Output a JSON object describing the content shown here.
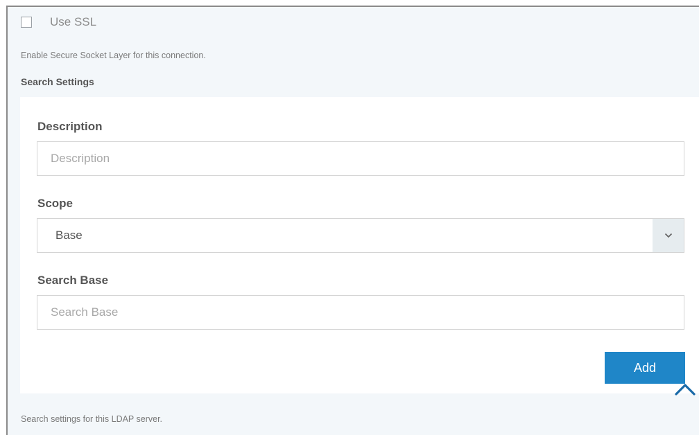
{
  "ssl": {
    "label": "Use SSL",
    "checked": false,
    "help": "Enable Secure Socket Layer for this connection."
  },
  "search_settings": {
    "title": "Search Settings",
    "fields": {
      "description": {
        "label": "Description",
        "placeholder": "Description",
        "value": ""
      },
      "scope": {
        "label": "Scope",
        "value": "Base"
      },
      "search_base": {
        "label": "Search Base",
        "placeholder": "Search Base",
        "value": ""
      }
    },
    "add_label": "Add",
    "help": "Search settings for this LDAP server."
  },
  "colors": {
    "accent": "#1f86c8",
    "frame_bg": "#f3f7fa",
    "panel_bg": "#ffffff",
    "toggle_bg": "#e6ecef",
    "scroll_arrow": "#1a6aa8"
  },
  "icons": {
    "select_toggle": "chevron-down-icon",
    "scroll_up": "chevron-up-icon"
  }
}
